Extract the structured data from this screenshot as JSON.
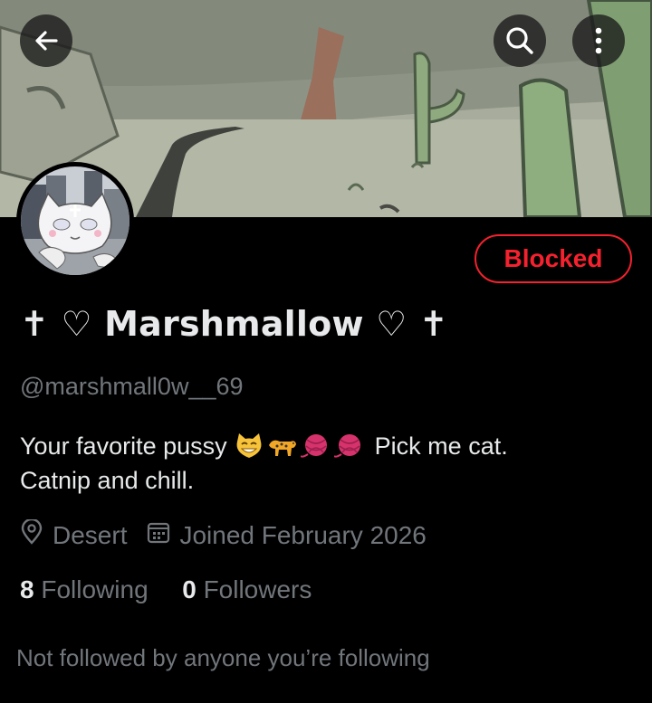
{
  "header": {
    "back_icon": "arrow-left-icon",
    "search_icon": "search-icon",
    "more_icon": "more-vertical-icon"
  },
  "profile": {
    "display_name": "✝ ♡ Marshmallow ♡ ✝",
    "handle": "@marshmall0w__69",
    "blocked_label": "Blocked",
    "bio_part1": "Your favorite pussy",
    "bio_emojis": [
      "grinning-cat-emoji",
      "leopard-emoji",
      "yarn-emoji",
      "yarn-emoji"
    ],
    "bio_part2": "Pick me cat.",
    "bio_line2": "Catnip and chill.",
    "location": "Desert",
    "joined": "Joined February 2026",
    "following_count": "8",
    "following_label": "Following",
    "followers_count": "0",
    "followers_label": "Followers",
    "not_followed_text": "Not followed by anyone you’re following"
  },
  "colors": {
    "background": "#000000",
    "text_primary": "#e7e9ea",
    "text_secondary": "#71767b",
    "blocked_red": "#f4212e"
  }
}
